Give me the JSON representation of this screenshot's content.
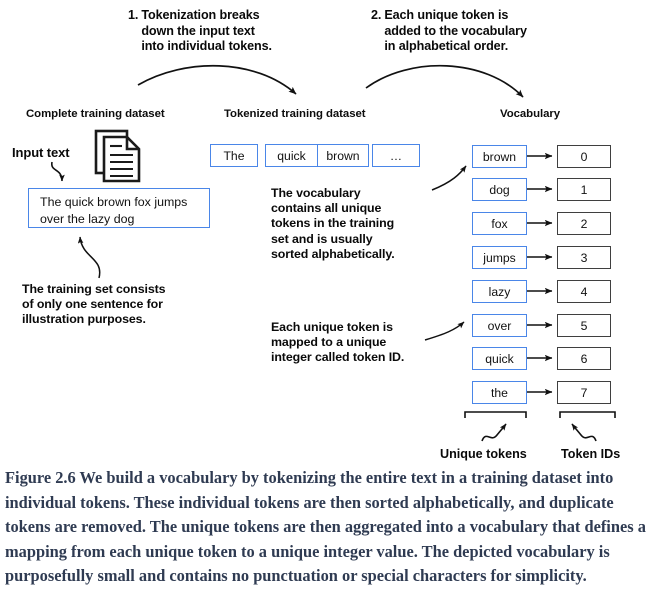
{
  "steps": [
    {
      "index": "1.",
      "text": "Tokenization breaks\ndown the input text\ninto individual tokens."
    },
    {
      "index": "2.",
      "text": "Each unique token is\nadded to the vocabulary\nin alphabetical order."
    }
  ],
  "columns": {
    "complete": "Complete training dataset",
    "tokenized": "Tokenized training dataset",
    "vocabulary": "Vocabulary"
  },
  "input": {
    "label": "Input text",
    "sentence": "The quick brown fox jumps\nover the lazy dog",
    "icon": "document-icon"
  },
  "tokens": [
    "The",
    "quick",
    "brown",
    "…"
  ],
  "vocabulary": [
    {
      "token": "brown",
      "id": "0"
    },
    {
      "token": "dog",
      "id": "1"
    },
    {
      "token": "fox",
      "id": "2"
    },
    {
      "token": "jumps",
      "id": "3"
    },
    {
      "token": "lazy",
      "id": "4"
    },
    {
      "token": "over",
      "id": "5"
    },
    {
      "token": "quick",
      "id": "6"
    },
    {
      "token": "the",
      "id": "7"
    }
  ],
  "annotations": {
    "vocab_note": "The vocabulary\ncontains all unique\ntokens in the training\nset and is usually\nsorted alphabetically.",
    "training_note": "The training set consists\nof only one sentence for\nillustration purposes.",
    "mapping_note": "Each unique token is\nmapped to a unique\ninteger called token ID."
  },
  "group_labels": {
    "tokens": "Unique tokens",
    "ids": "Token IDs"
  },
  "caption": "Figure 2.6 We build a vocabulary by tokenizing the entire text in a training dataset into individual tokens. These individual tokens are then sorted alphabetically, and duplicate tokens are removed. The unique tokens are then aggregated into a vocabulary that defines a mapping from each unique token to a unique integer value. The depicted vocabulary is purposefully small and contains no punctuation or special characters for simplicity.",
  "colors": {
    "token_border": "#4a86e8",
    "id_border": "#3f3f3f",
    "caption_text": "#2f3b52",
    "arrow": "#111111"
  }
}
